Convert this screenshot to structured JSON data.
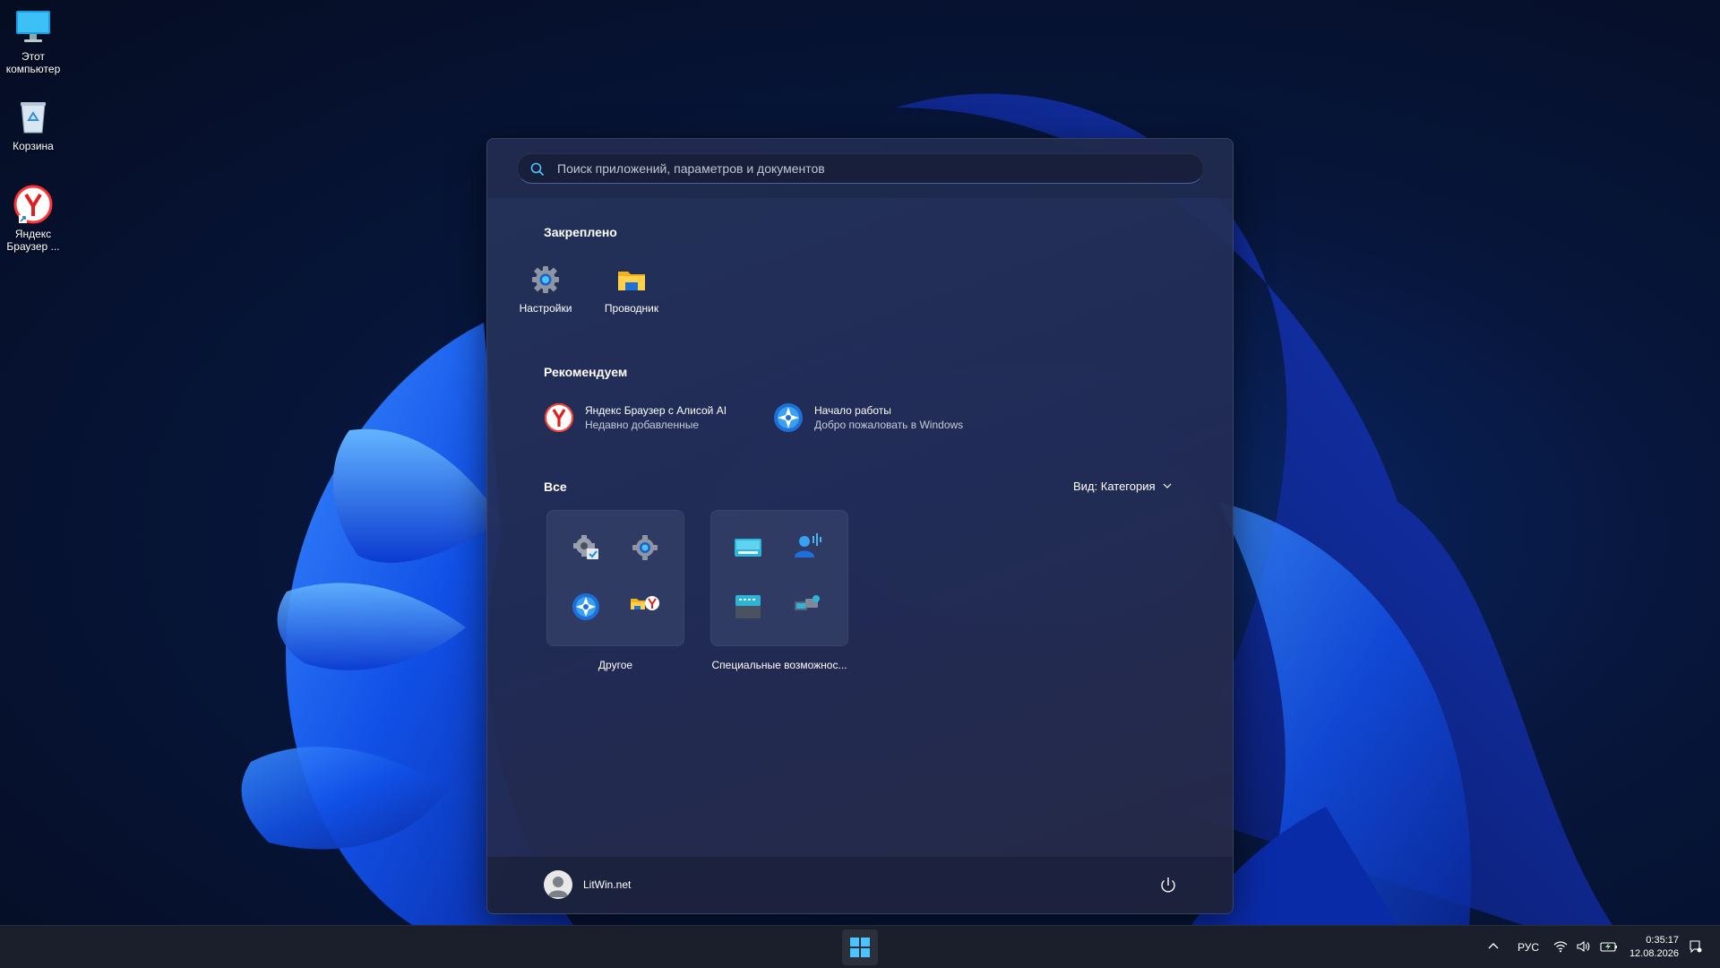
{
  "desktop": {
    "icons": [
      {
        "label": "Этот компьютер",
        "icon": "monitor-icon"
      },
      {
        "label": "Корзина",
        "icon": "recycle-bin-icon"
      },
      {
        "label": "Яндекс Браузер ...",
        "icon": "yandex-browser-icon"
      }
    ]
  },
  "start_menu": {
    "search": {
      "placeholder": "Поиск приложений, параметров и документов",
      "value": ""
    },
    "pinned": {
      "title": "Закреплено",
      "items": [
        {
          "label": "Настройки",
          "icon": "settings-gear-icon"
        },
        {
          "label": "Проводник",
          "icon": "file-explorer-folder-icon"
        }
      ]
    },
    "recommended": {
      "title": "Рекомендуем",
      "items": [
        {
          "title": "Яндекс Браузер с Алисой AI",
          "subtitle": "Недавно добавленные",
          "icon": "yandex-browser-icon"
        },
        {
          "title": "Начало работы",
          "subtitle": "Добро пожаловать в Windows",
          "icon": "get-started-icon"
        }
      ]
    },
    "all": {
      "title": "Все",
      "view_label": "Вид: Категория",
      "categories": [
        {
          "label": "Другое",
          "icons": [
            "system-settings-check-icon",
            "settings-gear-icon",
            "get-started-icon",
            "explorer-yandex-icon"
          ]
        },
        {
          "label": "Специальные возможнос...",
          "icons": [
            "on-screen-keyboard-icon",
            "voice-access-icon",
            "keyboard-terminal-icon",
            "remote-desktop-icon"
          ]
        }
      ]
    },
    "user": {
      "name": "LitWin.net"
    },
    "colors": {
      "accent": "#4cc2ff",
      "panel": "#26345c"
    }
  },
  "taskbar": {
    "language": "РУС",
    "time": "0:35:17",
    "date": "12.08.2026",
    "tray_icons": [
      "chevron-up-icon",
      "wifi-icon",
      "volume-icon",
      "battery-icon",
      "notification-icon"
    ]
  }
}
